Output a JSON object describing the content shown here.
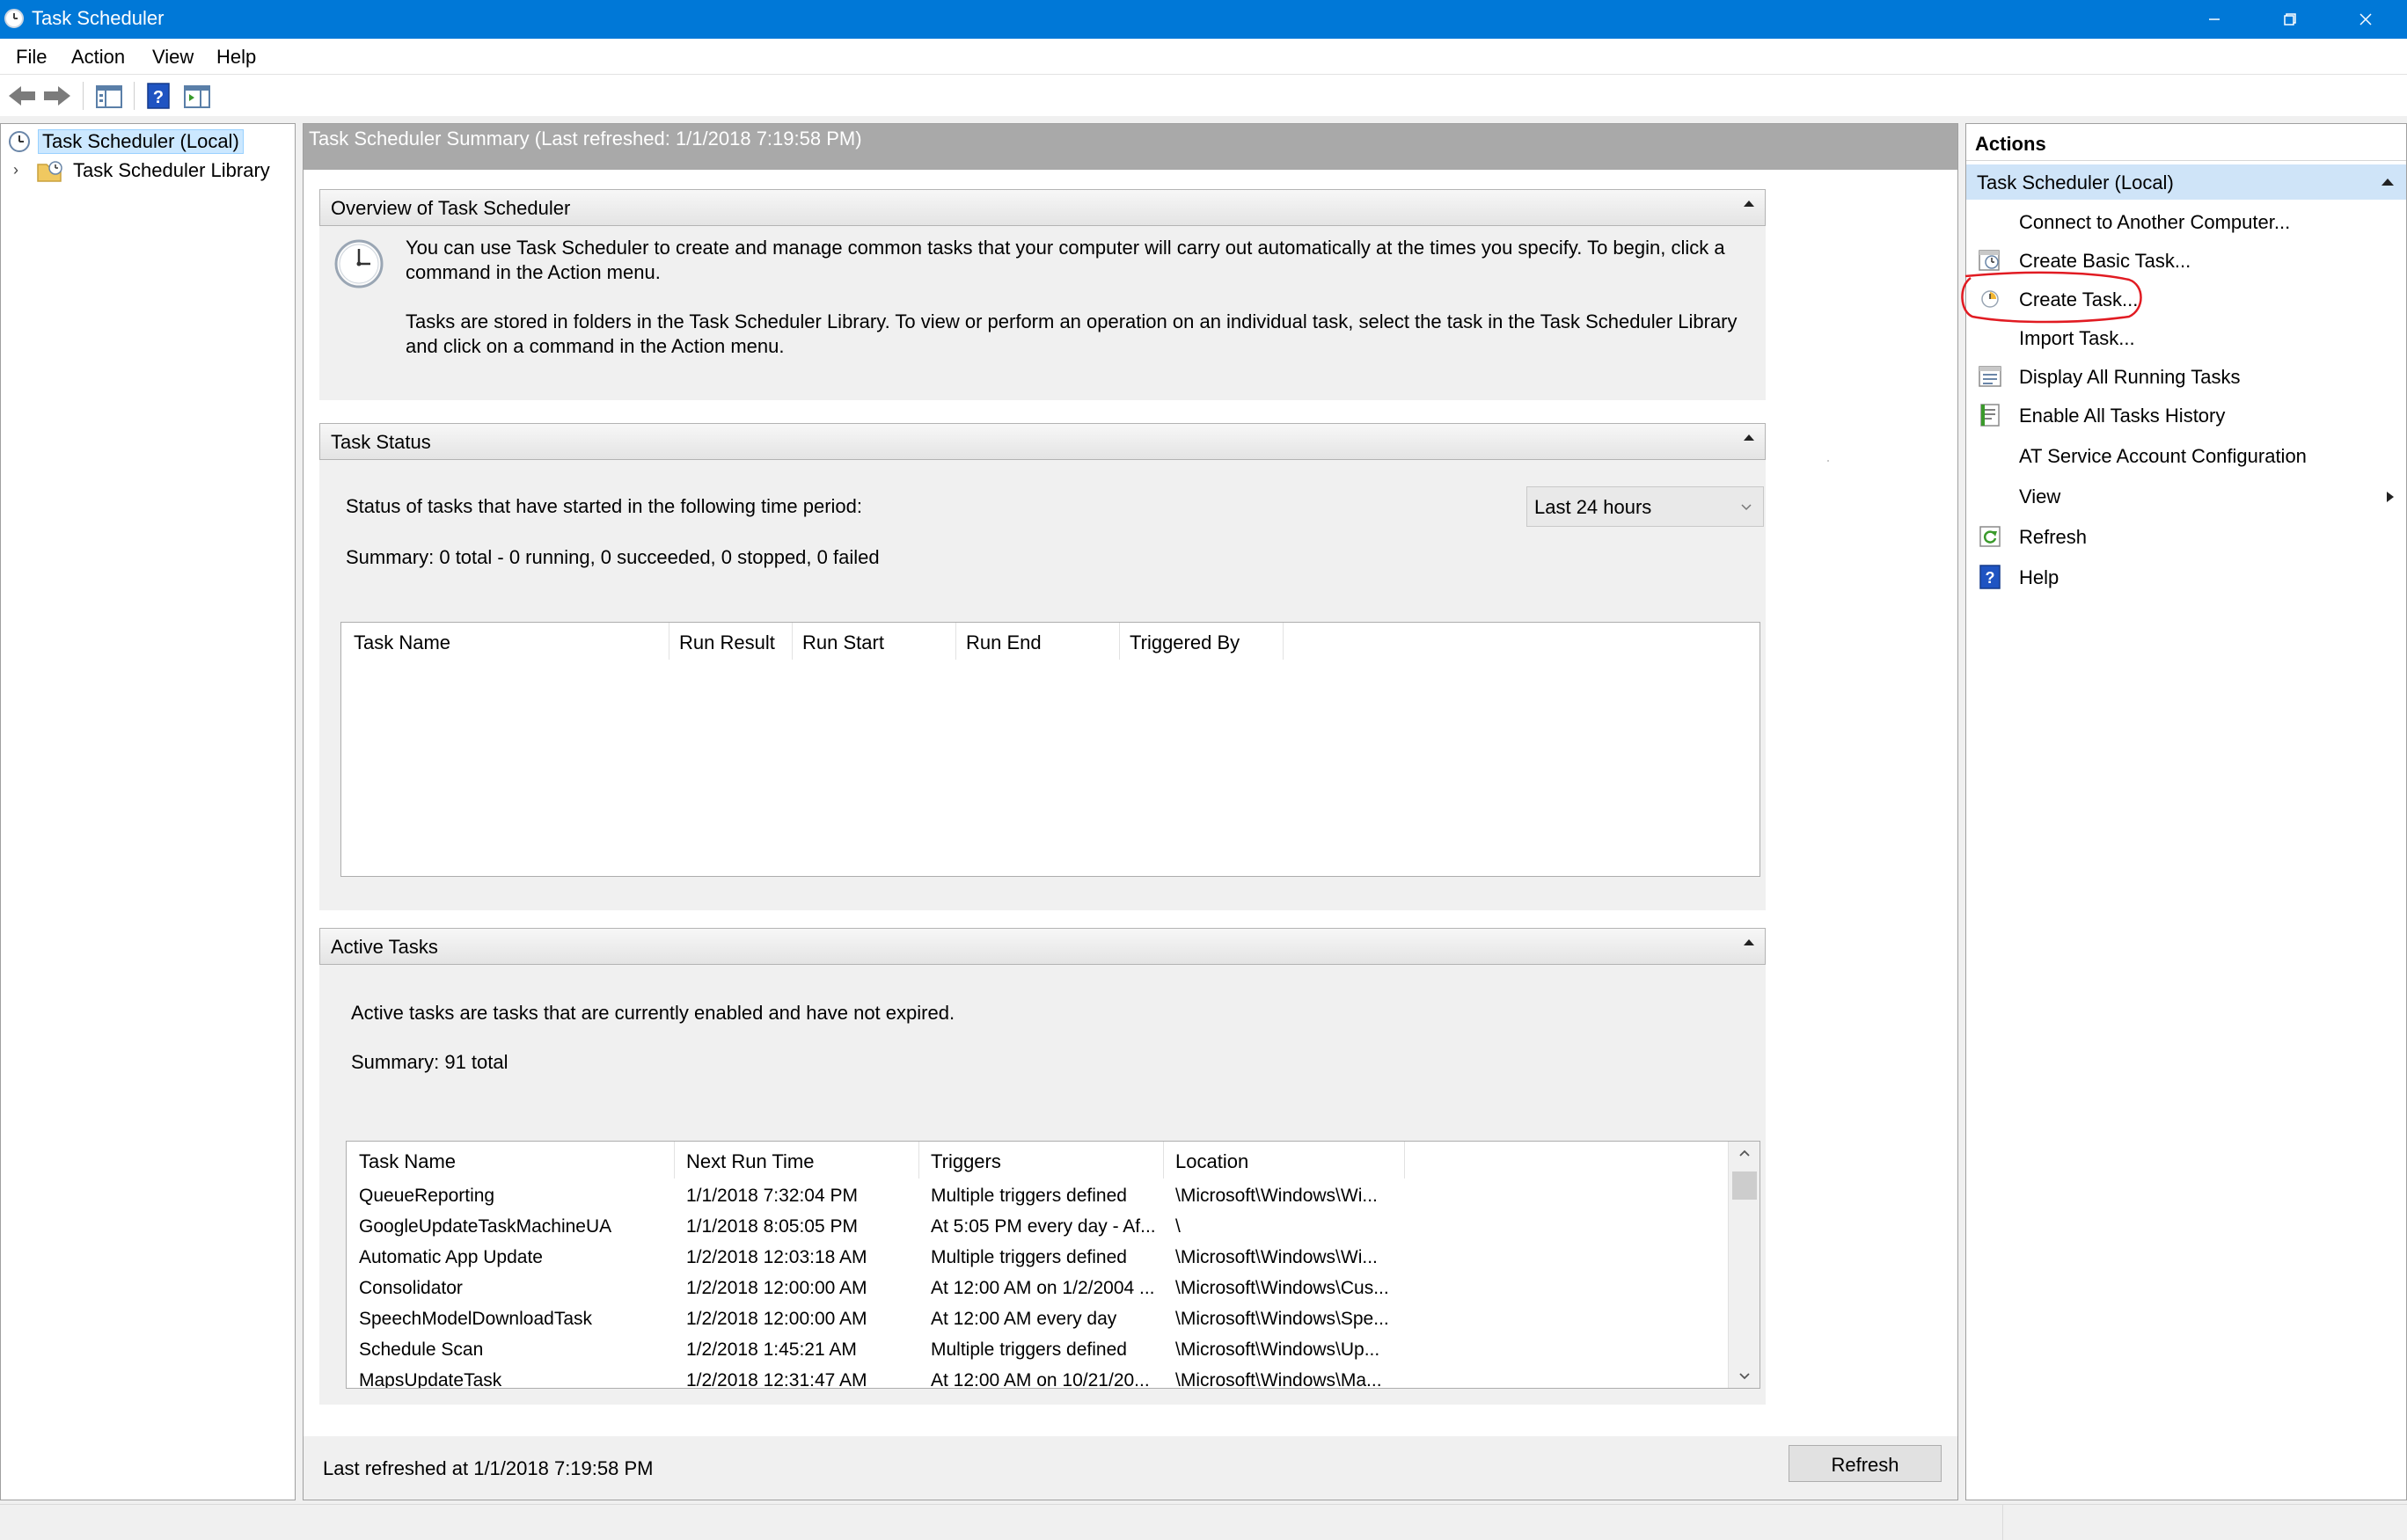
{
  "window": {
    "title": "Task Scheduler",
    "controls": [
      "minimize",
      "restore",
      "close"
    ]
  },
  "menu": [
    "File",
    "Action",
    "View",
    "Help"
  ],
  "toolbar": {
    "buttons": [
      "back-arrow-icon",
      "forward-arrow-icon",
      "show-hide-console-tree-icon",
      "help-icon",
      "show-hide-action-pane-icon"
    ]
  },
  "tree": {
    "items": [
      {
        "label": "Task Scheduler (Local)",
        "selected": true,
        "icon": "clock-icon"
      },
      {
        "label": "Task Scheduler Library",
        "selected": false,
        "icon": "folder-clock-icon"
      }
    ]
  },
  "center": {
    "header": "Task Scheduler Summary (Last refreshed: 1/1/2018 7:19:58 PM)",
    "overview": {
      "title": "Overview of Task Scheduler",
      "para1_line1": "You can use Task Scheduler to create and manage common tasks that your computer will carry out automatically at the times you specify. To begin, click a",
      "para1_line2": "command in the Action menu.",
      "para2_line1": "Tasks are stored in folders in the Task Scheduler Library. To view or perform an operation on an individual task, select the task in the Task Scheduler Library",
      "para2_line2": "and click on a command in the Action menu."
    },
    "task_status": {
      "title": "Task Status",
      "period_label": "Status of tasks that have started in the following time period:",
      "period_value": "Last 24 hours",
      "summary": "Summary: 0 total - 0 running, 0 succeeded, 0 stopped, 0 failed",
      "columns": [
        "Task Name",
        "Run Result",
        "Run Start",
        "Run End",
        "Triggered By"
      ]
    },
    "active_tasks": {
      "title": "Active Tasks",
      "description": "Active tasks are tasks that are currently enabled and have not expired.",
      "summary": "Summary: 91 total",
      "columns": [
        "Task Name",
        "Next Run Time",
        "Triggers",
        "Location"
      ],
      "rows": [
        [
          "QueueReporting",
          "1/1/2018 7:32:04 PM",
          "Multiple triggers defined",
          "\\Microsoft\\Windows\\Wi..."
        ],
        [
          "GoogleUpdateTaskMachineUA",
          "1/1/2018 8:05:05 PM",
          "At 5:05 PM every day - Af...",
          "\\"
        ],
        [
          "Automatic App Update",
          "1/2/2018 12:03:18 AM",
          "Multiple triggers defined",
          "\\Microsoft\\Windows\\Wi..."
        ],
        [
          "Consolidator",
          "1/2/2018 12:00:00 AM",
          "At 12:00 AM on 1/2/2004 ...",
          "\\Microsoft\\Windows\\Cus..."
        ],
        [
          "SpeechModelDownloadTask",
          "1/2/2018 12:00:00 AM",
          "At 12:00 AM every day",
          "\\Microsoft\\Windows\\Spe..."
        ],
        [
          "Schedule Scan",
          "1/2/2018 1:45:21 AM",
          "Multiple triggers defined",
          "\\Microsoft\\Windows\\Up..."
        ],
        [
          "MapsUpdateTask",
          "1/2/2018 12:31:47 AM",
          "At 12:00 AM on 10/21/20...",
          "\\Microsoft\\Windows\\Ma..."
        ]
      ]
    },
    "footer": {
      "last_refreshed": "Last refreshed at 1/1/2018 7:19:58 PM",
      "refresh_button": "Refresh"
    }
  },
  "actions": {
    "title": "Actions",
    "group": "Task Scheduler (Local)",
    "items": [
      {
        "label": "Connect to Another Computer...",
        "icon": ""
      },
      {
        "label": "Create Basic Task...",
        "icon": "create-basic-task-icon"
      },
      {
        "label": "Create Task...",
        "icon": "create-task-icon",
        "highlighted": true
      },
      {
        "label": "Import Task...",
        "icon": ""
      },
      {
        "label": "Display All Running Tasks",
        "icon": "running-tasks-icon"
      },
      {
        "label": "Enable All Tasks History",
        "icon": "task-history-icon"
      },
      {
        "label": "AT Service Account Configuration",
        "icon": ""
      },
      {
        "label": "View",
        "icon": "",
        "submenu": true
      },
      {
        "label": "Refresh",
        "icon": "refresh-icon"
      },
      {
        "label": "Help",
        "icon": "help-icon"
      }
    ]
  },
  "colors": {
    "titlebar": "#0078d7",
    "selection": "#cce8ff",
    "actions_group": "#cfe4f8",
    "highlight_annotation": "#e11b22"
  }
}
